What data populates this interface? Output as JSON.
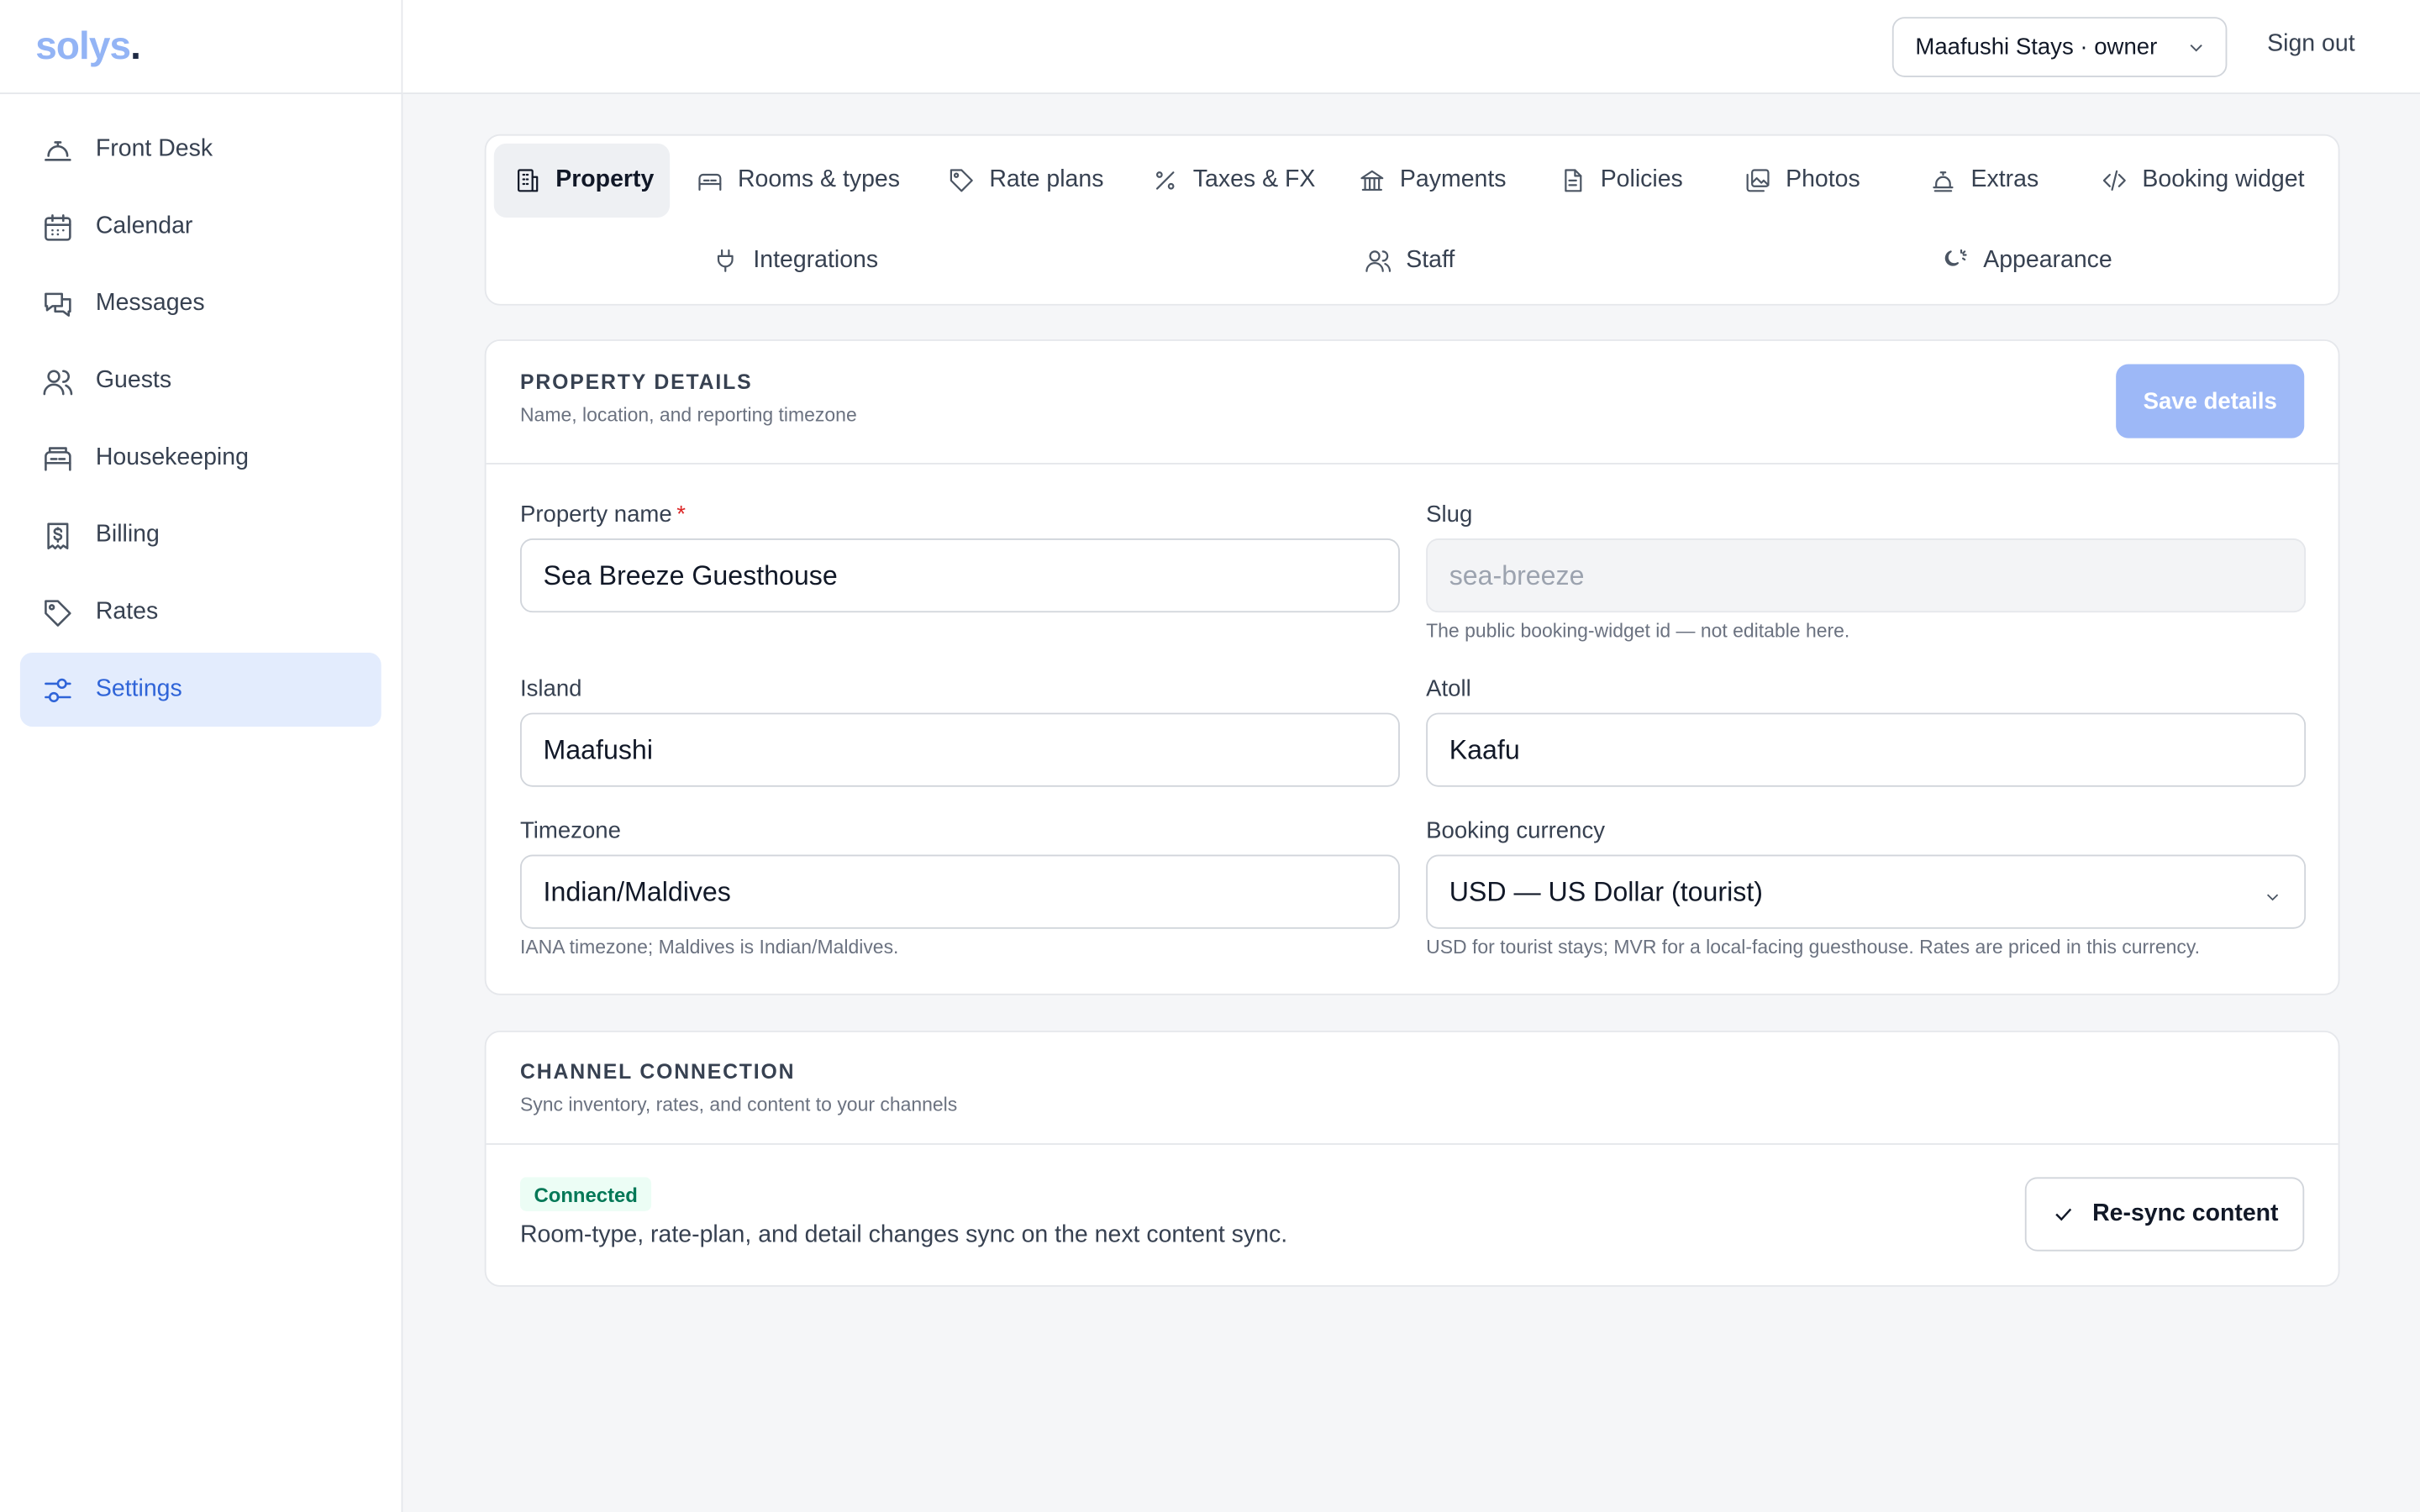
{
  "app": {
    "logo": "solys",
    "logo_dot": "."
  },
  "sidebar": {
    "items": [
      {
        "label": "Front Desk",
        "icon": "bell-icon"
      },
      {
        "label": "Calendar",
        "icon": "calendar-icon"
      },
      {
        "label": "Messages",
        "icon": "messages-icon"
      },
      {
        "label": "Guests",
        "icon": "users-icon"
      },
      {
        "label": "Housekeeping",
        "icon": "bed-icon"
      },
      {
        "label": "Billing",
        "icon": "receipt-icon"
      },
      {
        "label": "Rates",
        "icon": "tag-icon"
      },
      {
        "label": "Settings",
        "icon": "sliders-icon",
        "active": true
      }
    ]
  },
  "header": {
    "org_select": "Maafushi Stays · owner",
    "sign_out": "Sign out"
  },
  "tabs": [
    {
      "label": "Property",
      "icon": "building-icon",
      "active": true
    },
    {
      "label": "Rooms & types",
      "icon": "bed-icon"
    },
    {
      "label": "Rate plans",
      "icon": "tag-icon"
    },
    {
      "label": "Taxes & FX",
      "icon": "percent-icon"
    },
    {
      "label": "Payments",
      "icon": "bank-icon"
    },
    {
      "label": "Policies",
      "icon": "document-icon"
    },
    {
      "label": "Photos",
      "icon": "images-icon"
    },
    {
      "label": "Extras",
      "icon": "concierge-icon"
    },
    {
      "label": "Booking widget",
      "icon": "code-icon"
    },
    {
      "label": "Integrations",
      "icon": "plug-icon"
    },
    {
      "label": "Staff",
      "icon": "users-icon"
    },
    {
      "label": "Appearance",
      "icon": "sun-moon-icon"
    }
  ],
  "property_details": {
    "title": "PROPERTY DETAILS",
    "subtitle": "Name, location, and reporting timezone",
    "save_label": "Save details",
    "property_name_label": "Property name",
    "required_mark": "*",
    "property_name_value": "Sea Breeze Guesthouse",
    "slug_label": "Slug",
    "slug_value": "sea-breeze",
    "slug_hint": "The public booking-widget id — not editable here.",
    "island_label": "Island",
    "island_value": "Maafushi",
    "atoll_label": "Atoll",
    "atoll_value": "Kaafu",
    "timezone_label": "Timezone",
    "timezone_value": "Indian/Maldives",
    "timezone_hint": "IANA timezone; Maldives is Indian/Maldives.",
    "currency_label": "Booking currency",
    "currency_value": "USD — US Dollar (tourist)",
    "currency_hint": "USD for tourist stays; MVR for a local-facing guesthouse. Rates are priced in this currency."
  },
  "channel": {
    "title": "CHANNEL CONNECTION",
    "subtitle": "Sync inventory, rates, and content to your channels",
    "status": "Connected",
    "status_color": "#047857",
    "description": "Room-type, rate-plan, and detail changes sync on the next content sync.",
    "resync_label": "Re-sync content"
  },
  "colors": {
    "accent": "#2f64d8",
    "primary_button": "#9db8f7",
    "active_nav_bg": "#e3ecfd"
  }
}
